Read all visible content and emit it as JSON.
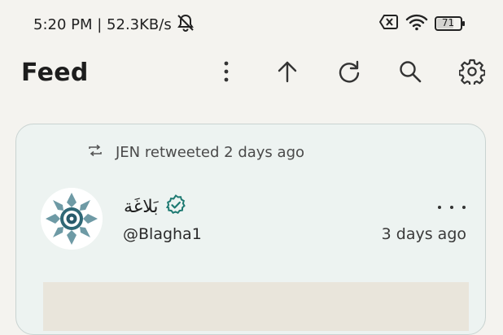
{
  "status": {
    "time_speed": "5:20 PM | 52.3KB/s",
    "battery": "71",
    "icons": [
      "muted-bell-icon",
      "sim-error-icon",
      "wifi-icon",
      "battery-icon"
    ]
  },
  "appbar": {
    "title": "Feed",
    "actions": [
      "overflow-menu-icon",
      "scroll-top-icon",
      "refresh-icon",
      "search-icon",
      "settings-icon"
    ]
  },
  "post": {
    "retweet_text": "JEN retweeted 2 days ago",
    "display_name": "بَلاغَة",
    "handle": "@Blagha1",
    "time": "3 days ago",
    "verified": true
  },
  "colors": {
    "background": "#f4f3ef",
    "card": "#edf3f1",
    "accent": "#1e7a72"
  }
}
